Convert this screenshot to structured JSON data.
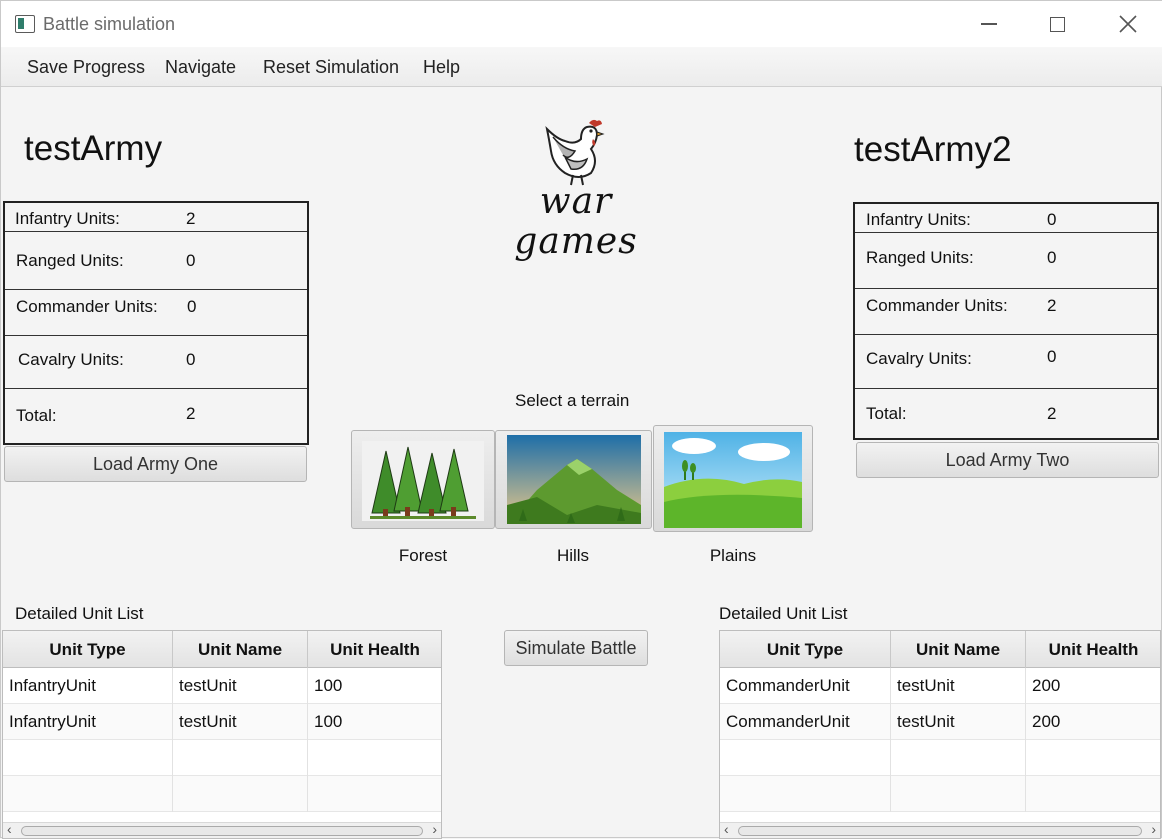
{
  "window": {
    "title": "Battle simulation"
  },
  "menu": [
    "Save Progress",
    "Navigate",
    "Reset Simulation",
    "Help"
  ],
  "army1": {
    "name": "testArmy",
    "stats": [
      {
        "label": "Infantry Units:",
        "value": "2"
      },
      {
        "label": "Ranged Units:",
        "value": "0"
      },
      {
        "label": "Commander Units:",
        "value": "0"
      },
      {
        "label": "Cavalry Units:",
        "value": "0"
      },
      {
        "label": "Total:",
        "value": "2"
      }
    ],
    "load_button": "Load Army One",
    "list_label": "Detailed Unit List",
    "columns": [
      "Unit Type",
      "Unit Name",
      "Unit Health"
    ],
    "rows": [
      [
        "InfantryUnit",
        "testUnit",
        "100"
      ],
      [
        "InfantryUnit",
        "testUnit",
        "100"
      ]
    ]
  },
  "army2": {
    "name": "testArmy2",
    "stats": [
      {
        "label": "Infantry Units:",
        "value": "0"
      },
      {
        "label": "Ranged Units:",
        "value": "0"
      },
      {
        "label": "Commander Units:",
        "value": "2"
      },
      {
        "label": "Cavalry Units:",
        "value": "0"
      },
      {
        "label": "Total:",
        "value": "2"
      }
    ],
    "load_button": "Load Army Two",
    "list_label": "Detailed Unit List",
    "columns": [
      "Unit Type",
      "Unit Name",
      "Unit Health"
    ],
    "rows": [
      [
        "CommanderUnit",
        "testUnit",
        "200"
      ],
      [
        "CommanderUnit",
        "testUnit",
        "200"
      ]
    ]
  },
  "logo": {
    "line1": "war",
    "line2": "games",
    "icon": "chicken-icon"
  },
  "terrain": {
    "heading": "Select a terrain",
    "options": [
      "Forest",
      "Hills",
      "Plains"
    ]
  },
  "simulate_button": "Simulate Battle"
}
